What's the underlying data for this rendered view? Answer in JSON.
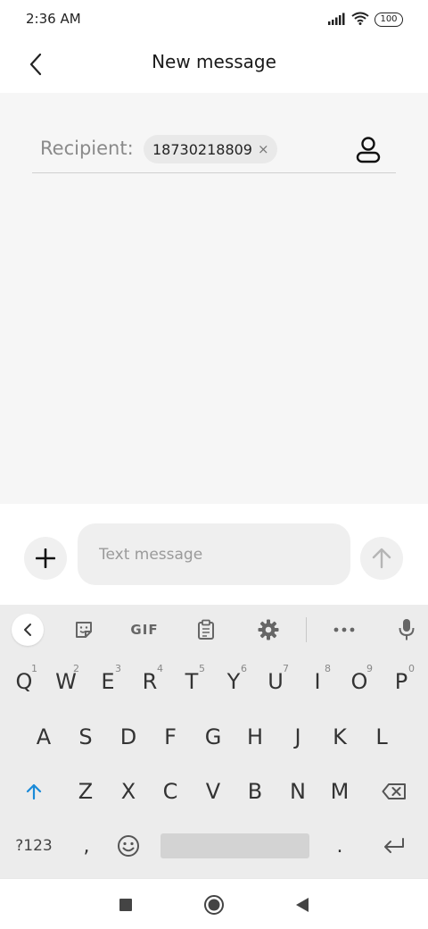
{
  "status_bar": {
    "time": "2:36 AM",
    "battery": "100"
  },
  "header": {
    "title": "New message"
  },
  "recipient": {
    "label": "Recipient:",
    "chip": "18730218809",
    "remove": "×"
  },
  "compose": {
    "placeholder": "Text message"
  },
  "keyboard": {
    "gif_label": "GIF",
    "row1": [
      {
        "key": "Q",
        "hint": "1"
      },
      {
        "key": "W",
        "hint": "2"
      },
      {
        "key": "E",
        "hint": "3"
      },
      {
        "key": "R",
        "hint": "4"
      },
      {
        "key": "T",
        "hint": "5"
      },
      {
        "key": "Y",
        "hint": "6"
      },
      {
        "key": "U",
        "hint": "7"
      },
      {
        "key": "I",
        "hint": "8"
      },
      {
        "key": "O",
        "hint": "9"
      },
      {
        "key": "P",
        "hint": "0"
      }
    ],
    "row2": [
      "A",
      "S",
      "D",
      "F",
      "G",
      "H",
      "J",
      "K",
      "L"
    ],
    "row3": [
      "Z",
      "X",
      "C",
      "V",
      "B",
      "N",
      "M"
    ],
    "symbols_label": "?123",
    "comma": ",",
    "period": "."
  },
  "colors": {
    "shift_active": "#1a8ad8",
    "content_bg": "#f6f6f6",
    "keyboard_bg": "#ececec"
  }
}
